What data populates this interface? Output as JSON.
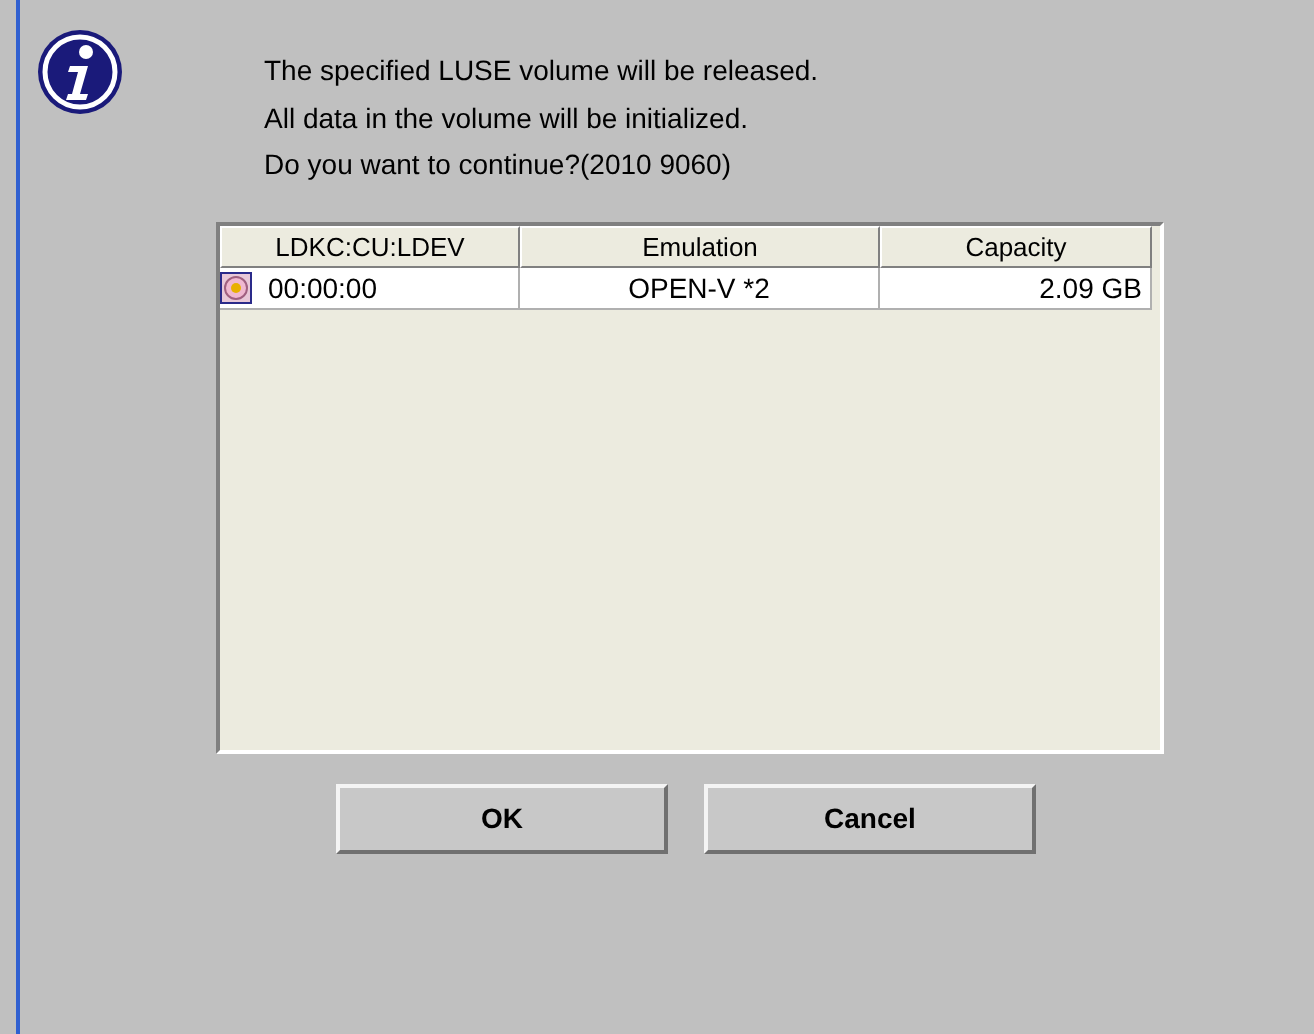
{
  "message": [
    "The specified LUSE volume will be released.",
    "All data in the volume will be initialized.",
    "Do you want to continue?(2010 9060)"
  ],
  "table": {
    "columns": [
      "LDKC:CU:LDEV",
      "Emulation",
      "Capacity"
    ],
    "rows": [
      {
        "ldev": "00:00:00",
        "emulation": "OPEN-V *2",
        "capacity": "2.09 GB"
      }
    ]
  },
  "buttons": [
    "OK",
    "Cancel"
  ]
}
